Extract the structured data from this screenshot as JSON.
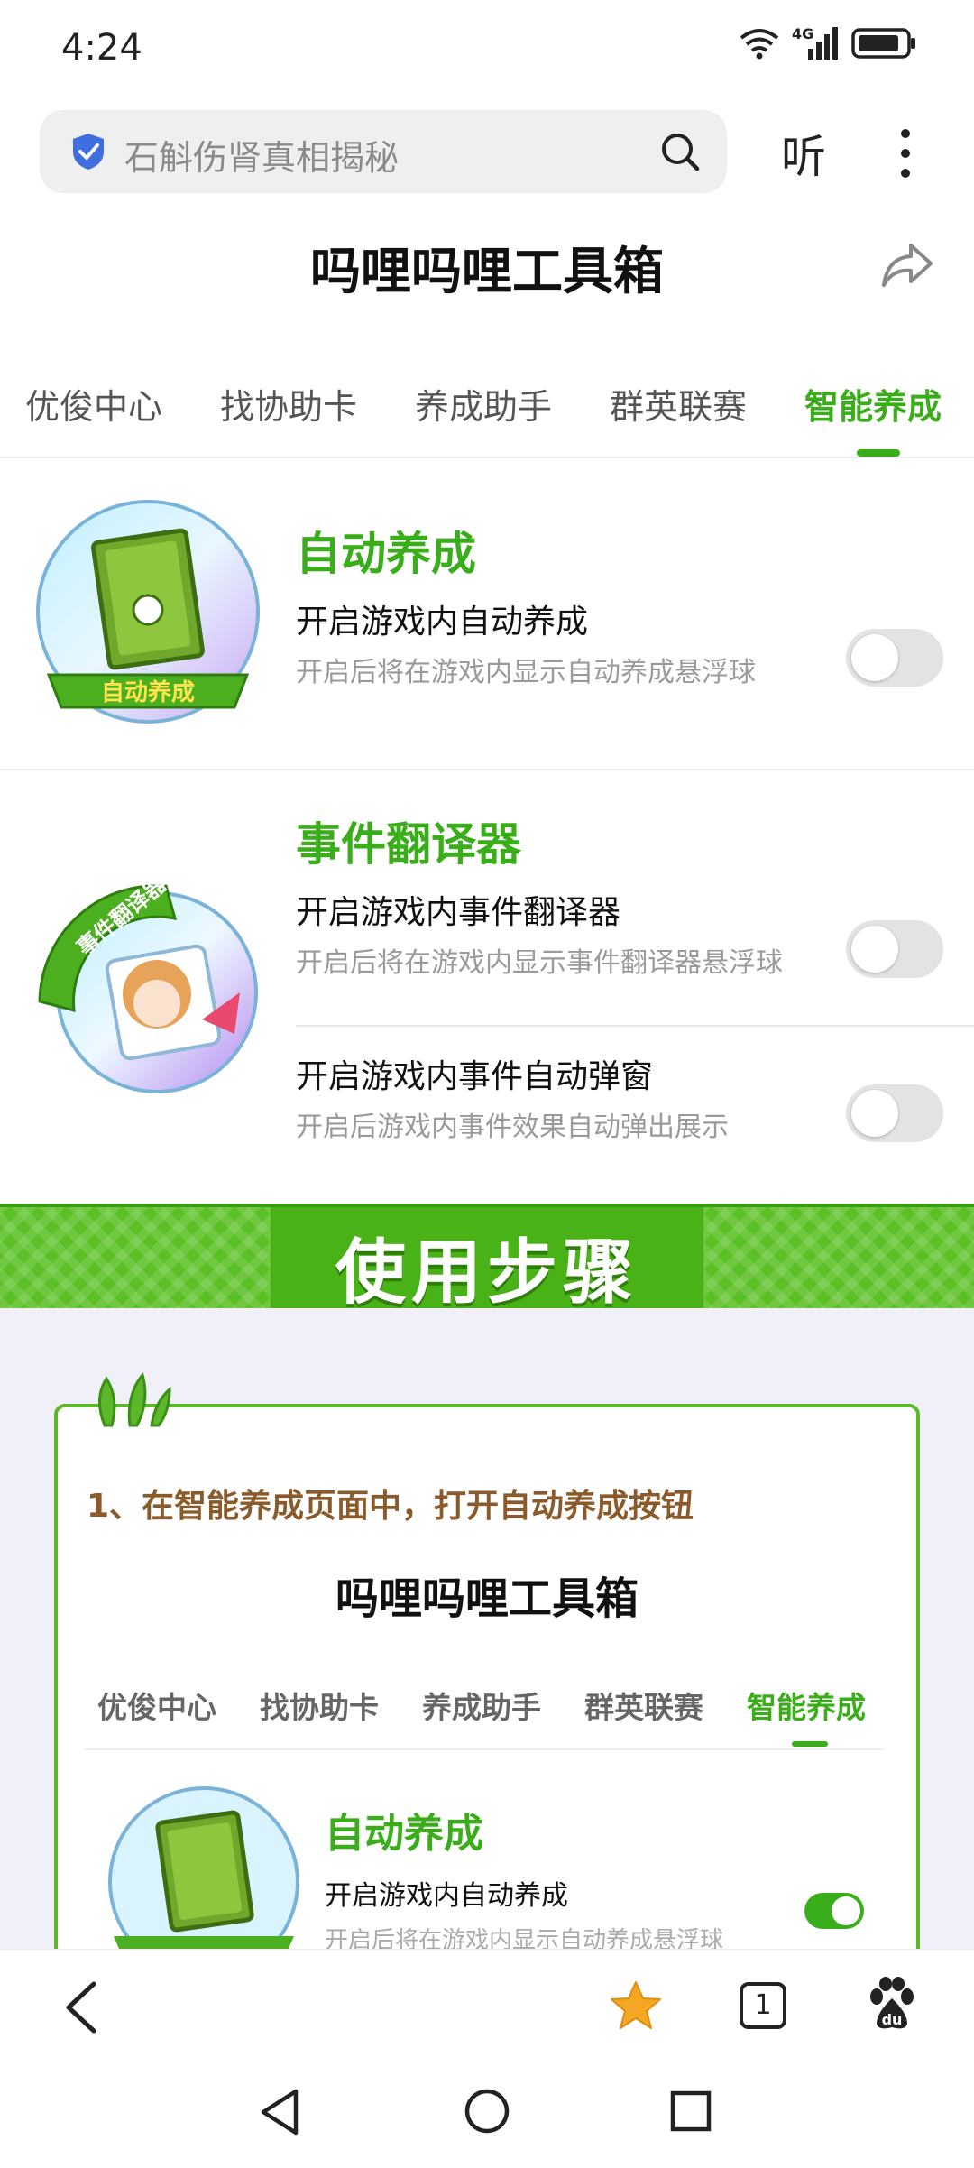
{
  "status_bar": {
    "time": "4:24",
    "network": "4G"
  },
  "search": {
    "text": "石斛伤肾真相揭秘"
  },
  "header": {
    "listen_label": "听",
    "title": "吗哩吗哩工具箱"
  },
  "tabs": [
    {
      "label": "优俊中心",
      "active": false
    },
    {
      "label": "找协助卡",
      "active": false
    },
    {
      "label": "养成助手",
      "active": false
    },
    {
      "label": "群英联赛",
      "active": false
    },
    {
      "label": "智能养成",
      "active": true
    }
  ],
  "features": {
    "auto_train": {
      "badge_text": "自动养成",
      "title": "自动养成",
      "rows": [
        {
          "title": "开启游戏内自动养成",
          "subtitle": "开启后将在游戏内显示自动养成悬浮球",
          "enabled": false
        }
      ]
    },
    "event_translator": {
      "badge_text": "事件翻译器",
      "title": "事件翻译器",
      "rows": [
        {
          "title": "开启游戏内事件翻译器",
          "subtitle": "开启后将在游戏内显示事件翻译器悬浮球",
          "enabled": false
        },
        {
          "title": "开启游戏内事件自动弹窗",
          "subtitle": "开启后游戏内事件效果自动弹出展示",
          "enabled": false
        }
      ]
    }
  },
  "guide": {
    "banner_title": "使用步骤",
    "step_text": "1、在智能养成页面中，打开自动养成按钮",
    "preview": {
      "title": "吗哩吗哩工具箱",
      "tabs": [
        "优俊中心",
        "找协助卡",
        "养成助手",
        "群英联赛",
        "智能养成"
      ],
      "feature_title": "自动养成",
      "row_title": "开启游戏内自动养成",
      "row_subtitle": "开启后将在游戏内显示自动养成悬浮球",
      "enabled": true
    }
  },
  "toolbar": {
    "tab_count": "1"
  },
  "colors": {
    "accent": "#3aae1a",
    "banner": "#5bc025",
    "star": "#f5a623"
  }
}
